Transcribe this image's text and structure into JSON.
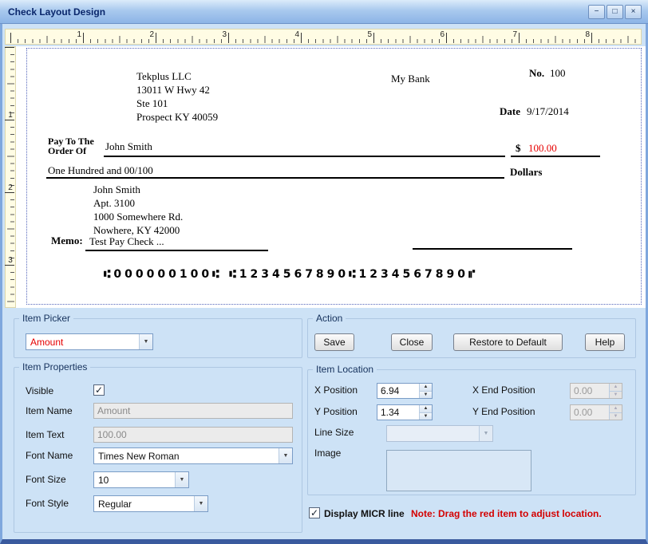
{
  "window": {
    "title": "Check Layout Design",
    "minimize_glyph": "−",
    "maximize_glyph": "□",
    "close_glyph": "×"
  },
  "ruler": {
    "h": [
      "1",
      "2",
      "3",
      "4",
      "5",
      "6",
      "7",
      "8"
    ],
    "v": [
      "1",
      "2",
      "3"
    ]
  },
  "check": {
    "company": [
      "Tekplus LLC",
      "13011 W Hwy 42",
      "Ste 101",
      "Prospect KY 40059"
    ],
    "bank_name": "My Bank",
    "no_label": "No.",
    "check_number": "100",
    "date_label": "Date",
    "date_value": "9/17/2014",
    "pay_to_line1": "Pay To The",
    "pay_to_line2": "Order Of",
    "payee": "John Smith",
    "dollar_sign": "$",
    "amount": "100.00",
    "amount_words": "One Hundred  and 00/100",
    "dollars_label": "Dollars",
    "address": [
      "John Smith",
      "Apt. 3100",
      "1000 Somewhere Rd.",
      "Nowhere, KY 42000"
    ],
    "memo_label": "Memo:",
    "memo_text": "Test Pay Check ...",
    "micr": "⑆000000100⑆ ⑆1234567890⑆1234567890⑈"
  },
  "panel": {
    "item_picker": {
      "label": "Item Picker",
      "value": "Amount"
    },
    "action": {
      "label": "Action",
      "buttons": [
        "Save",
        "Close",
        "Restore to Default",
        "Help"
      ]
    },
    "item_properties": {
      "label": "Item Properties",
      "visible_label": "Visible",
      "item_name_label": "Item Name",
      "item_name_value": "Amount",
      "item_text_label": "Item Text",
      "item_text_value": "100.00",
      "font_name_label": "Font Name",
      "font_name_value": "Times New Roman",
      "font_size_label": "Font Size",
      "font_size_value": "10",
      "font_style_label": "Font Style",
      "font_style_value": "Regular"
    },
    "item_location": {
      "label": "Item Location",
      "x_position_label": "X Position",
      "x_position_value": "6.94",
      "x_end_label": "X End Position",
      "x_end_value": "0.00",
      "y_position_label": "Y Position",
      "y_position_value": "1.34",
      "y_end_label": "Y End Position",
      "y_end_value": "0.00",
      "line_size_label": "Line Size",
      "image_label": "Image"
    },
    "micr_checkbox_label": "Display MICR line",
    "checkmark_glyph": "✓",
    "note": "Note:  Drag the red item to adjust location."
  },
  "colors": {
    "item_red": "#e60000",
    "note_red": "#d40000",
    "panel_bg": "#cde2f6",
    "ruler_bg": "#fffce4",
    "titlebar_text": "#09266b"
  }
}
